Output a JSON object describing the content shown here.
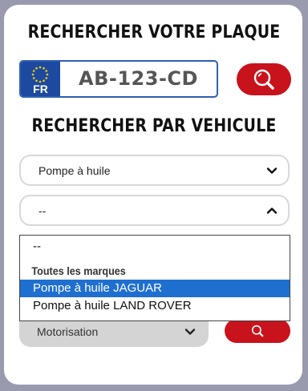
{
  "plate_section": {
    "heading": "RECHERCHER VOTRE PLAQUE",
    "country_code": "FR",
    "plate_value": "AB-123-CD",
    "search_icon": "search-icon"
  },
  "vehicle_section": {
    "heading": "RECHERCHER PAR VEHICULE",
    "product_select": {
      "value": "Pompe à huile",
      "icon": "chevron-down-icon"
    },
    "brand_select": {
      "value": "--",
      "icon": "chevron-up-icon"
    },
    "brand_options": {
      "empty": "--",
      "group_label": "Toutes les marques",
      "options": [
        "Pompe à huile JAGUAR",
        "Pompe à huile LAND ROVER"
      ],
      "selected_index": 0
    },
    "motor_select": {
      "value": "Motorisation",
      "icon": "chevron-down-icon"
    },
    "search_icon": "search-icon"
  },
  "colors": {
    "accent_red": "#c8131c",
    "plate_blue": "#1d4aa0",
    "selection_blue": "#1f6fd0"
  }
}
